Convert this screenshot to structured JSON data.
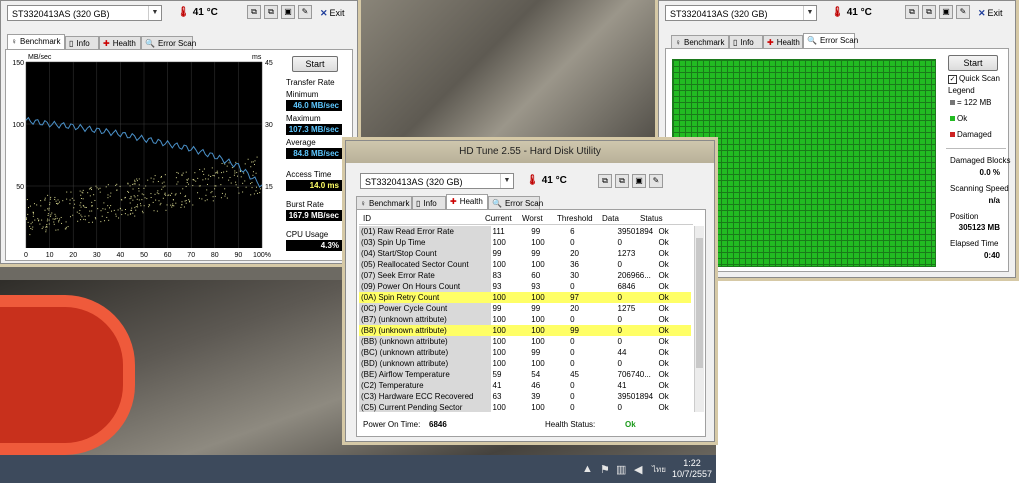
{
  "benchmark_window": {
    "drive": "ST3320413AS (320 GB)",
    "temperature": "41 °C",
    "exit_label": "Exit",
    "tabs": [
      "Benchmark",
      "Info",
      "Health",
      "Error Scan"
    ],
    "chart_title_left": "MB/sec",
    "chart_title_right": "ms",
    "start_label": "Start",
    "transfer_rate_label": "Transfer Rate",
    "minimum_label": "Minimum",
    "minimum_value": "46.0 MB/sec",
    "maximum_label": "Maximum",
    "maximum_value": "107.3 MB/sec",
    "average_label": "Average",
    "average_value": "84.8 MB/sec",
    "access_time_label": "Access Time",
    "access_time_value": "14.0 ms",
    "burst_rate_label": "Burst Rate",
    "burst_rate_value": "167.9 MB/sec",
    "cpu_usage_label": "CPU Usage",
    "cpu_usage_value": "4.3%"
  },
  "chart_data": {
    "type": "line",
    "x": [
      0,
      10,
      20,
      30,
      40,
      50,
      60,
      70,
      80,
      90,
      100
    ],
    "xticks": [
      "0",
      "10",
      "20",
      "30",
      "40",
      "50",
      "60",
      "70",
      "80",
      "90",
      "100%"
    ],
    "y_left_ticks": [
      "150",
      "100",
      "50"
    ],
    "y_right_ticks": [
      "45",
      "30",
      "15"
    ],
    "ylim": [
      0,
      150
    ],
    "series": [
      {
        "values": [
          103,
          100,
          98,
          95,
          92,
          88,
          84,
          80,
          74,
          66,
          50
        ],
        "color": "#4a90c8"
      }
    ],
    "access_points_color": "#d8d890"
  },
  "health_window": {
    "title": "HD Tune 2.55 - Hard Disk Utility",
    "drive": "ST3320413AS (320 GB)",
    "temperature": "41 °C",
    "tabs": [
      "Benchmark",
      "Info",
      "Health",
      "Error Scan"
    ],
    "columns": [
      "ID",
      "Current",
      "Worst",
      "Threshold",
      "Data",
      "Status"
    ],
    "rows": [
      [
        "(01) Raw Read Error Rate",
        "111",
        "99",
        "6",
        "39501894",
        "Ok"
      ],
      [
        "(03) Spin Up Time",
        "100",
        "100",
        "0",
        "0",
        "Ok"
      ],
      [
        "(04) Start/Stop Count",
        "99",
        "99",
        "20",
        "1273",
        "Ok"
      ],
      [
        "(05) Reallocated Sector Count",
        "100",
        "100",
        "36",
        "0",
        "Ok"
      ],
      [
        "(07) Seek Error Rate",
        "83",
        "60",
        "30",
        "206966...",
        "Ok"
      ],
      [
        "(09) Power On Hours Count",
        "93",
        "93",
        "0",
        "6846",
        "Ok"
      ],
      [
        "(0A) Spin Retry Count",
        "100",
        "100",
        "97",
        "0",
        "Ok"
      ],
      [
        "(0C) Power Cycle Count",
        "99",
        "99",
        "20",
        "1275",
        "Ok"
      ],
      [
        "(B7) (unknown attribute)",
        "100",
        "100",
        "0",
        "0",
        "Ok"
      ],
      [
        "(B8) (unknown attribute)",
        "100",
        "100",
        "99",
        "0",
        "Ok"
      ],
      [
        "(BB) (unknown attribute)",
        "100",
        "100",
        "0",
        "0",
        "Ok"
      ],
      [
        "(BC) (unknown attribute)",
        "100",
        "99",
        "0",
        "44",
        "Ok"
      ],
      [
        "(BD) (unknown attribute)",
        "100",
        "100",
        "0",
        "0",
        "Ok"
      ],
      [
        "(BE) Airflow Temperature",
        "59",
        "54",
        "45",
        "706740...",
        "Ok"
      ],
      [
        "(C2) Temperature",
        "41",
        "46",
        "0",
        "41",
        "Ok"
      ],
      [
        "(C3) Hardware ECC Recovered",
        "63",
        "39",
        "0",
        "39501894",
        "Ok"
      ],
      [
        "(C5) Current Pending Sector",
        "100",
        "100",
        "0",
        "0",
        "Ok"
      ]
    ],
    "highlighted_rows": [
      6,
      9
    ],
    "power_on_label": "Power On Time:",
    "power_on_value": "6846",
    "health_status_label": "Health Status:",
    "health_status_value": "Ok"
  },
  "errorscan_window": {
    "drive": "ST3320413AS (320 GB)",
    "temperature": "41 °C",
    "exit_label": "Exit",
    "tabs": [
      "Benchmark",
      "Info",
      "Health",
      "Error Scan"
    ],
    "start_label": "Start",
    "quick_scan_label": "Quick Scan",
    "quick_scan_checked": true,
    "legend_label": "Legend",
    "legend_block": "= 122 MB",
    "legend_ok": "Ok",
    "legend_damaged": "Damaged",
    "damaged_blocks_label": "Damaged Blocks",
    "damaged_blocks_value": "0.0 %",
    "scanning_speed_label": "Scanning Speed",
    "scanning_speed_value": "n/a",
    "position_label": "Position",
    "position_value": "305123 MB",
    "elapsed_label": "Elapsed Time",
    "elapsed_value": "0:40",
    "ok_color": "#22bb22",
    "damaged_color": "#cc2222"
  },
  "taskbar": {
    "time": "1:22",
    "date": "10/7/2557"
  }
}
